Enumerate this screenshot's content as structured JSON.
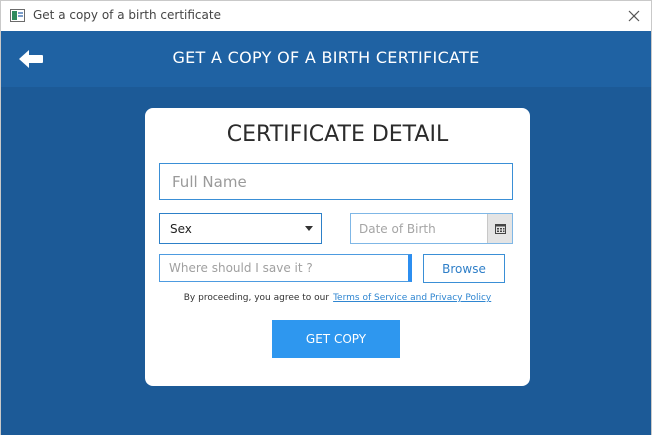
{
  "window": {
    "title": "Get a copy of a birth certificate"
  },
  "header": {
    "title": "GET A COPY OF A BIRTH CERTIFICATE"
  },
  "card": {
    "title": "CERTIFICATE DETAIL",
    "full_name": {
      "value": "",
      "placeholder": "Full Name"
    },
    "sex": {
      "selected": "Sex"
    },
    "date_of_birth": {
      "value": "",
      "placeholder": "Date of Birth"
    },
    "save_path": {
      "value": "",
      "placeholder": "Where should I save it ?"
    },
    "browse_label": "Browse",
    "terms_prefix": "By proceeding, you agree to our",
    "terms_link": "Terms of Service and Privacy Policy",
    "submit_label": "GET COPY"
  },
  "colors": {
    "background": "#1c5a97",
    "header": "#1f62a3",
    "accent": "#2e97ef",
    "field_border": "#3a8fd6"
  },
  "icons": {
    "app": "app-window-icon",
    "close": "close-icon",
    "back": "back-arrow-icon",
    "dropdown": "chevron-down-icon",
    "calendar": "calendar-icon"
  }
}
